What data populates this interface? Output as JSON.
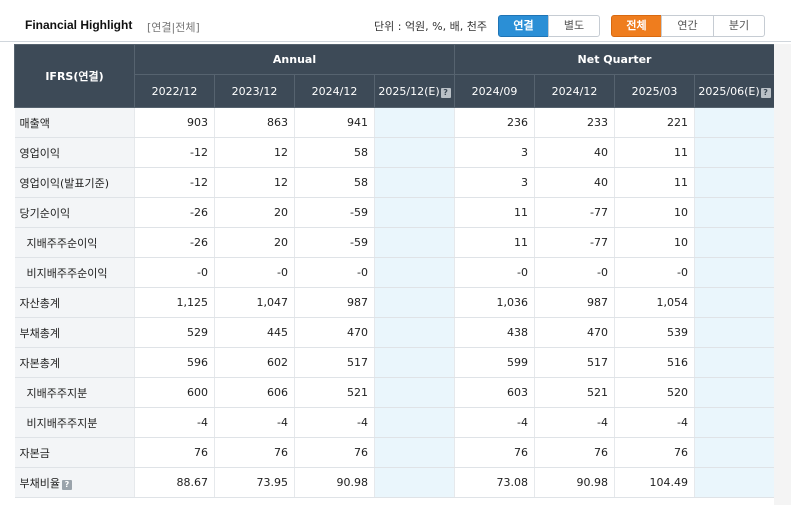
{
  "header": {
    "title": "Financial Highlight",
    "subtitle": "[연결|전체]",
    "unit": "단위 : 억원, %, 배, 천주",
    "scope_toggle": [
      "연결",
      "별도"
    ],
    "period_toggle": [
      "전체",
      "연간",
      "분기"
    ]
  },
  "table": {
    "stub_header": "IFRS(연결)",
    "groups": [
      "Annual",
      "Net Quarter"
    ],
    "columns": [
      "2022/12",
      "2023/12",
      "2024/12",
      "2025/12(E)",
      "2024/09",
      "2024/12",
      "2025/03",
      "2025/06(E)"
    ],
    "rows": [
      {
        "label": "매출액",
        "values": [
          "903",
          "863",
          "941",
          "",
          "236",
          "233",
          "221",
          ""
        ]
      },
      {
        "label": "영업이익",
        "values": [
          "-12",
          "12",
          "58",
          "",
          "3",
          "40",
          "11",
          ""
        ]
      },
      {
        "label": "영업이익(발표기준)",
        "values": [
          "-12",
          "12",
          "58",
          "",
          "3",
          "40",
          "11",
          ""
        ]
      },
      {
        "label": "당기순이익",
        "values": [
          "-26",
          "20",
          "-59",
          "",
          "11",
          "-77",
          "10",
          ""
        ]
      },
      {
        "label": "지배주주순이익",
        "values": [
          "-26",
          "20",
          "-59",
          "",
          "11",
          "-77",
          "10",
          ""
        ]
      },
      {
        "label": "비지배주주순이익",
        "values": [
          "-0",
          "-0",
          "-0",
          "",
          "-0",
          "-0",
          "-0",
          ""
        ]
      },
      {
        "label": "자산총계",
        "values": [
          "1,125",
          "1,047",
          "987",
          "",
          "1,036",
          "987",
          "1,054",
          ""
        ]
      },
      {
        "label": "부채총계",
        "values": [
          "529",
          "445",
          "470",
          "",
          "438",
          "470",
          "539",
          ""
        ]
      },
      {
        "label": "자본총계",
        "values": [
          "596",
          "602",
          "517",
          "",
          "599",
          "517",
          "516",
          ""
        ]
      },
      {
        "label": "지배주주지분",
        "values": [
          "600",
          "606",
          "521",
          "",
          "603",
          "521",
          "520",
          ""
        ]
      },
      {
        "label": "비지배주주지분",
        "values": [
          "-4",
          "-4",
          "-4",
          "",
          "-4",
          "-4",
          "-4",
          ""
        ]
      },
      {
        "label": "자본금",
        "values": [
          "76",
          "76",
          "76",
          "",
          "76",
          "76",
          "76",
          ""
        ]
      },
      {
        "label": "부채비율",
        "values": [
          "88.67",
          "73.95",
          "90.98",
          "",
          "73.08",
          "90.98",
          "104.49",
          ""
        ]
      }
    ]
  }
}
